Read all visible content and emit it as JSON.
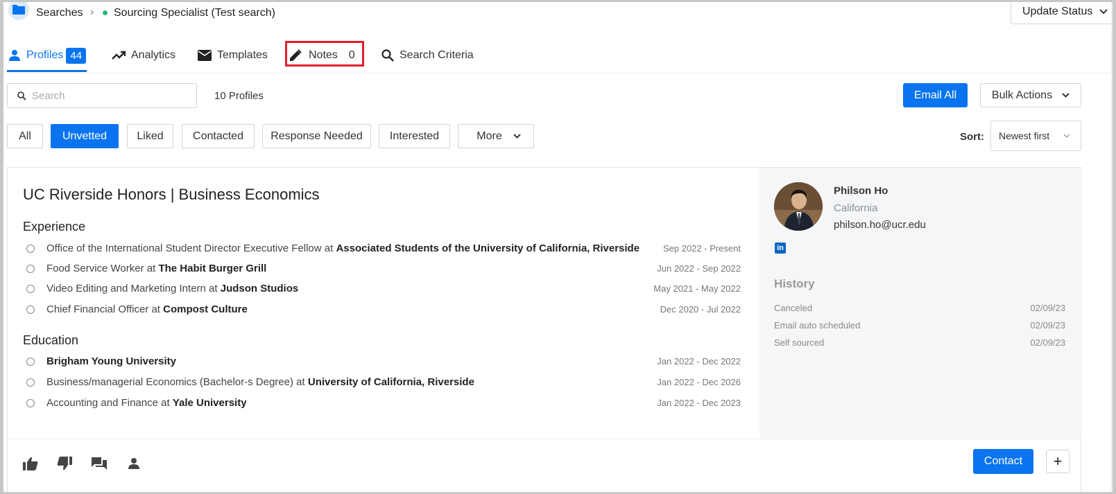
{
  "breadcrumb": {
    "root": "Searches",
    "current": "Sourcing Specialist (Test search)"
  },
  "update_status": "Update Status",
  "tabs": [
    {
      "label": "Profiles",
      "badge": "44"
    },
    {
      "label": "Analytics"
    },
    {
      "label": "Templates"
    },
    {
      "label": "Notes",
      "badge": "0"
    },
    {
      "label": "Search Criteria"
    }
  ],
  "search": {
    "placeholder": "Search"
  },
  "profiles_count": "10 Profiles",
  "email_all": "Email All",
  "bulk_actions": "Bulk Actions",
  "filters": [
    "All",
    "Unvetted",
    "Liked",
    "Contacted",
    "Response Needed",
    "Interested",
    "More"
  ],
  "sort": {
    "label": "Sort:",
    "value": "Newest first"
  },
  "profile": {
    "headline": "UC Riverside Honors | Business Economics",
    "experience_title": "Experience",
    "experience": [
      {
        "role": "Office of the International Student Director Executive Fellow",
        "at": " at ",
        "org": "Associated Students of the University of California, Riverside",
        "dates": "Sep 2022 - Present"
      },
      {
        "role": "Food Service Worker",
        "at": " at ",
        "org": "The Habit Burger Grill",
        "dates": "Jun 2022 - Sep 2022"
      },
      {
        "role": "Video Editing and Marketing Intern",
        "at": " at ",
        "org": "Judson Studios",
        "dates": "May 2021 - May 2022"
      },
      {
        "role": "Chief Financial Officer",
        "at": " at ",
        "org": "Compost Culture",
        "dates": "Dec 2020 - Jul 2022"
      }
    ],
    "education_title": "Education",
    "education": [
      {
        "role": "",
        "at": "",
        "org": "Brigham Young University",
        "dates": "Jan 2022 - Dec 2022"
      },
      {
        "role": "Business/managerial Economics (Bachelor-s Degree)",
        "at": " at ",
        "org": "University of California, Riverside",
        "dates": "Jan 2022 - Dec 2026"
      },
      {
        "role": "Accounting and Finance",
        "at": " at ",
        "org": "Yale University",
        "dates": "Jan 2022 - Dec 2023"
      }
    ],
    "name": "Philson Ho",
    "location": "California",
    "email": "philson.ho@ucr.edu",
    "linkedin_label": "in",
    "history_title": "History",
    "history": [
      {
        "event": "Canceled",
        "date": "02/09/23"
      },
      {
        "event": "Email auto scheduled",
        "date": "02/09/23"
      },
      {
        "event": "Self sourced",
        "date": "02/09/23"
      }
    ]
  },
  "contact": "Contact",
  "plus": "+",
  "colors": {
    "accent": "#0a74f0",
    "highlight": "#e0202b",
    "status_dot": "#2bb673"
  }
}
